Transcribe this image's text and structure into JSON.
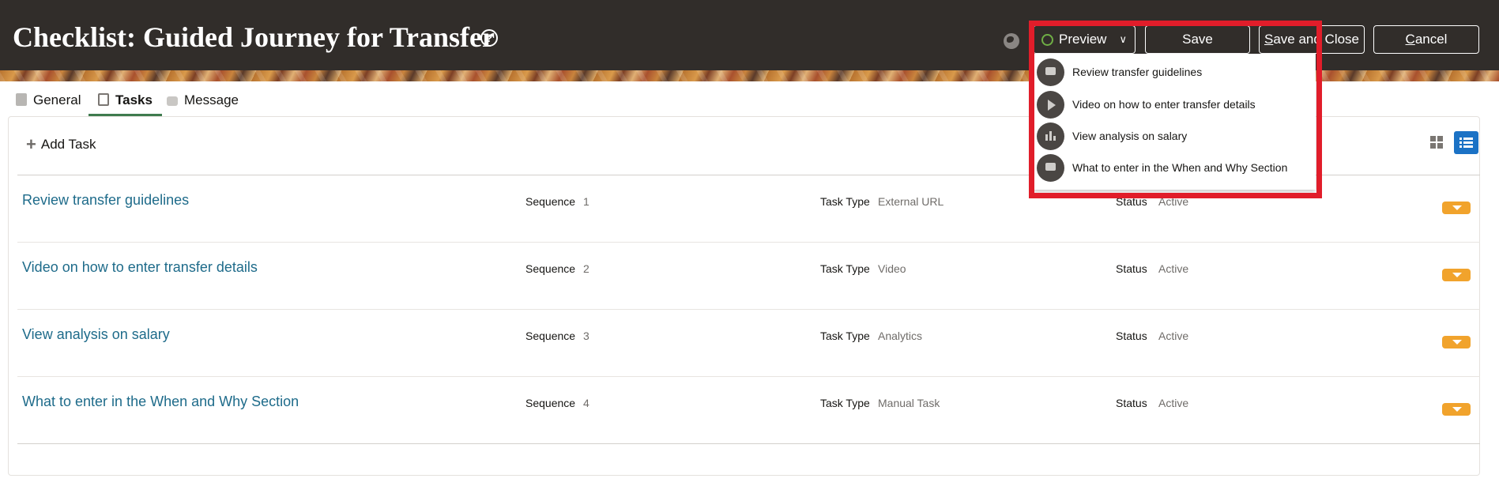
{
  "header": {
    "title": "Checklist: Guided Journey for Transfer",
    "help_icon": "?",
    "buttons": {
      "preview": "Preview",
      "save": "Save",
      "save_close": {
        "prefix": "S",
        "rest": "ave and Close"
      },
      "cancel": {
        "prefix": "C",
        "rest": "ancel"
      }
    }
  },
  "tabs": [
    {
      "label": "General",
      "icon": "document-icon"
    },
    {
      "label": "Tasks",
      "icon": "clipboard-icon",
      "selected": true
    },
    {
      "label": "Message",
      "icon": "message-icon"
    }
  ],
  "toolbar": {
    "add_task": "Add Task",
    "view_mode": "list"
  },
  "field_labels": {
    "sequence": "Sequence",
    "task_type": "Task Type",
    "status": "Status"
  },
  "tasks": [
    {
      "name": "Review transfer guidelines",
      "sequence": "1",
      "task_type": "External URL",
      "status": "Active"
    },
    {
      "name": "Video on how to enter transfer details",
      "sequence": "2",
      "task_type": "Video",
      "status": "Active"
    },
    {
      "name": "View analysis on salary",
      "sequence": "3",
      "task_type": "Analytics",
      "status": "Active"
    },
    {
      "name": "What to enter in the When and Why Section",
      "sequence": "4",
      "task_type": "Manual Task",
      "status": "Active"
    }
  ],
  "preview_menu": [
    {
      "label": "Review transfer guidelines",
      "icon": "chat-icon"
    },
    {
      "label": "Video on how to enter transfer details",
      "icon": "play-icon"
    },
    {
      "label": "View analysis on salary",
      "icon": "chart-icon"
    },
    {
      "label": "What to enter in the When and Why Section",
      "icon": "chat-icon"
    }
  ],
  "colors": {
    "header_bg": "#312d2a",
    "link": "#1e6b8a",
    "row_menu": "#f1a32c",
    "active_view": "#1b72c5",
    "highlight": "#e11d2a"
  }
}
